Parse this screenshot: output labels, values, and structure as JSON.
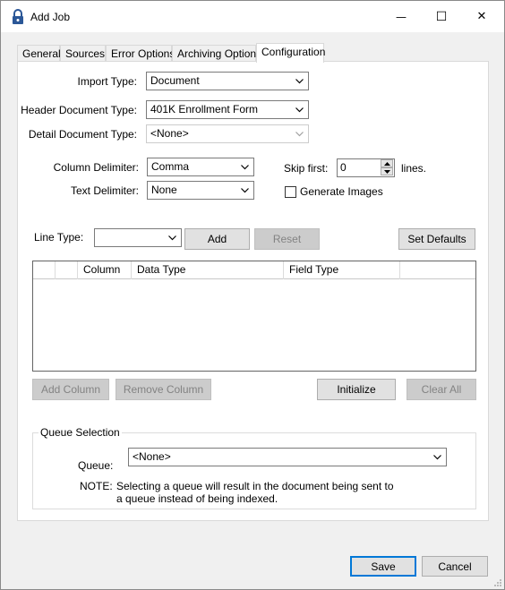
{
  "window": {
    "title": "Add Job",
    "minimize_glyph": "—",
    "maximize_glyph": "☐",
    "close_glyph": "✕"
  },
  "tabs": [
    {
      "label": "General"
    },
    {
      "label": "Sources"
    },
    {
      "label": "Error Options"
    },
    {
      "label": "Archiving Options"
    },
    {
      "label": "Configuration",
      "active": true
    }
  ],
  "form": {
    "import_type_label": "Import Type:",
    "import_type_value": "Document",
    "header_doc_label": "Header Document Type:",
    "header_doc_value": "401K Enrollment Form",
    "detail_doc_label": "Detail Document Type:",
    "detail_doc_value": "<None>",
    "column_delim_label": "Column Delimiter:",
    "column_delim_value": "Comma",
    "text_delim_label": "Text Delimiter:",
    "text_delim_value": "None",
    "skip_first_label": "Skip first:",
    "skip_first_value": "0",
    "lines_label": "lines.",
    "generate_images_label": "Generate Images",
    "generate_images_checked": false
  },
  "line_type": {
    "label": "Line Type:",
    "value": "",
    "add_label": "Add",
    "reset_label": "Reset",
    "set_defaults_label": "Set Defaults"
  },
  "grid": {
    "columns": [
      "",
      "",
      "Column",
      "Data Type",
      "Field Type",
      ""
    ]
  },
  "grid_buttons": {
    "add_column": "Add Column",
    "remove_column": "Remove Column",
    "initialize": "Initialize",
    "clear_all": "Clear All"
  },
  "queue": {
    "group_title": "Queue Selection",
    "label": "Queue:",
    "value": "<None>",
    "note_label": "NOTE:",
    "note_text": "Selecting a queue will result in the document being sent to a queue instead of being indexed."
  },
  "footer": {
    "save": "Save",
    "cancel": "Cancel"
  },
  "colors": {
    "accent": "#0078d7",
    "lock_icon": "#2b5797"
  }
}
